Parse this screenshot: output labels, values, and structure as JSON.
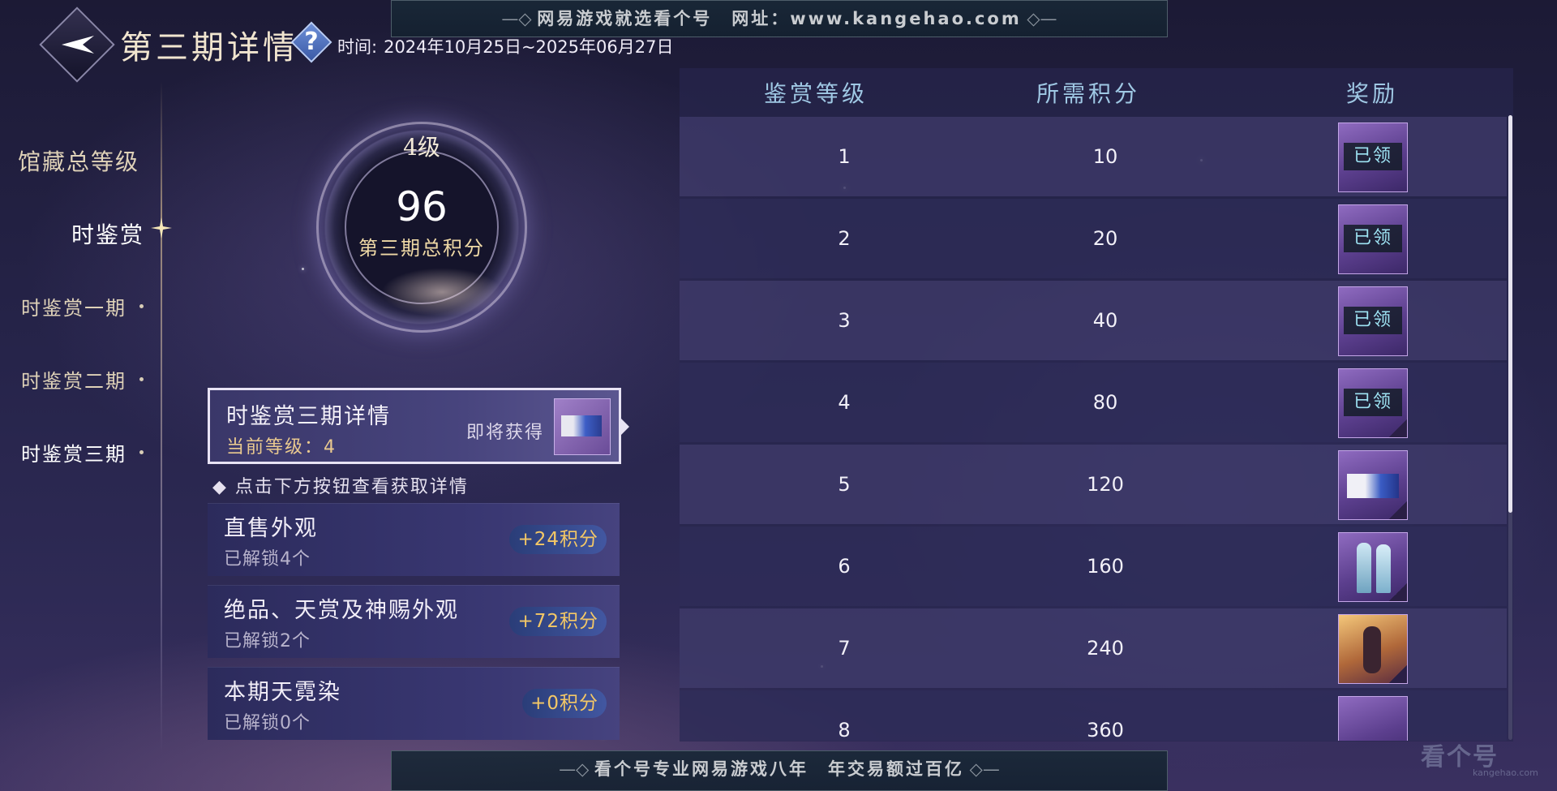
{
  "header": {
    "title": "第三期详情",
    "help_icon": "question-icon",
    "time_label": "时间:",
    "time_range": "2024年10月25日~2025年06月27日"
  },
  "banners": {
    "top": "网易游戏就选看个号　网址：www.kangehao.com",
    "bottom": "看个号专业网易游戏八年　年交易额过百亿"
  },
  "sidebar": {
    "items": [
      {
        "label": "馆藏总等级"
      },
      {
        "label": "时鉴赏"
      },
      {
        "label": "时鉴赏一期"
      },
      {
        "label": "时鉴赏二期"
      },
      {
        "label": "时鉴赏三期"
      }
    ]
  },
  "ring": {
    "level": "4级",
    "score": "96",
    "label": "第三期总积分"
  },
  "detail": {
    "title": "时鉴赏三期详情",
    "current_level": "当前等级：4",
    "upcoming": "即将获得"
  },
  "hint": "◆ 点击下方按钮查看获取详情",
  "sources": [
    {
      "title": "直售外观",
      "unlocked": "已解锁4个",
      "points": "+24积分"
    },
    {
      "title": "绝品、天赏及神赐外观",
      "unlocked": "已解锁2个",
      "points": "+72积分"
    },
    {
      "title": "本期天霓染",
      "unlocked": "已解锁0个",
      "points": "+0积分"
    }
  ],
  "table": {
    "headers": [
      "鉴赏等级",
      "所需积分",
      "奖励"
    ],
    "rows": [
      {
        "level": "1",
        "points": "10",
        "claimed": "已领"
      },
      {
        "level": "2",
        "points": "20",
        "claimed": "已领"
      },
      {
        "level": "3",
        "points": "40",
        "claimed": "已领"
      },
      {
        "level": "4",
        "points": "80",
        "claimed": "已领"
      },
      {
        "level": "5",
        "points": "120",
        "claimed": ""
      },
      {
        "level": "6",
        "points": "160",
        "claimed": ""
      },
      {
        "level": "7",
        "points": "240",
        "claimed": ""
      },
      {
        "level": "8",
        "points": "360",
        "claimed": ""
      }
    ]
  },
  "watermark": {
    "name": "看个号",
    "url": "kangehao.com"
  }
}
